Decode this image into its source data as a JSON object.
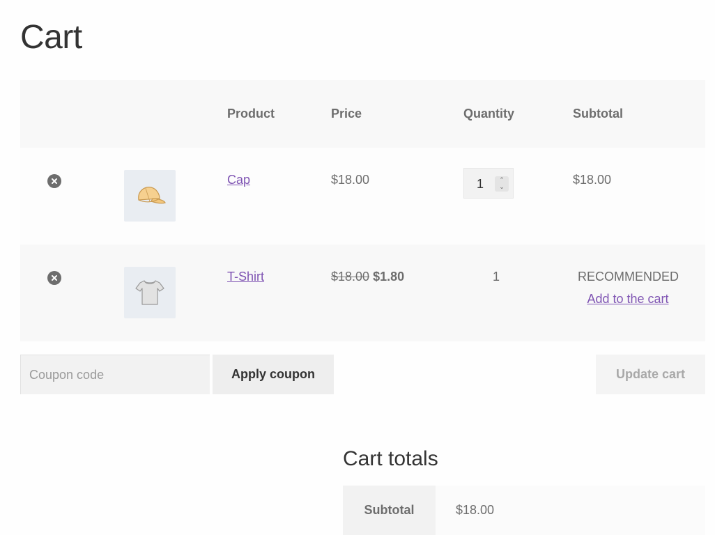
{
  "page": {
    "title": "Cart"
  },
  "cart_table": {
    "headers": {
      "product": "Product",
      "price": "Price",
      "quantity": "Quantity",
      "subtotal": "Subtotal"
    },
    "items": [
      {
        "name": "Cap",
        "price": "$18.00",
        "quantity": "1",
        "subtotal": "$18.00",
        "thumbnail": "cap-icon"
      },
      {
        "name": "T-Shirt",
        "price_old": "$18.00",
        "price_new": "$1.80",
        "quantity": "1",
        "status": "RECOMMENDED",
        "action": "Add to the cart",
        "thumbnail": "tshirt-icon"
      }
    ]
  },
  "actions": {
    "coupon_placeholder": "Coupon code",
    "apply_label": "Apply coupon",
    "update_label": "Update cart"
  },
  "totals": {
    "title": "Cart totals",
    "subtotal_label": "Subtotal",
    "subtotal_value": "$18.00"
  },
  "colors": {
    "link": "#7f54b3",
    "text": "#6d6d6d",
    "heading": "#333333"
  }
}
